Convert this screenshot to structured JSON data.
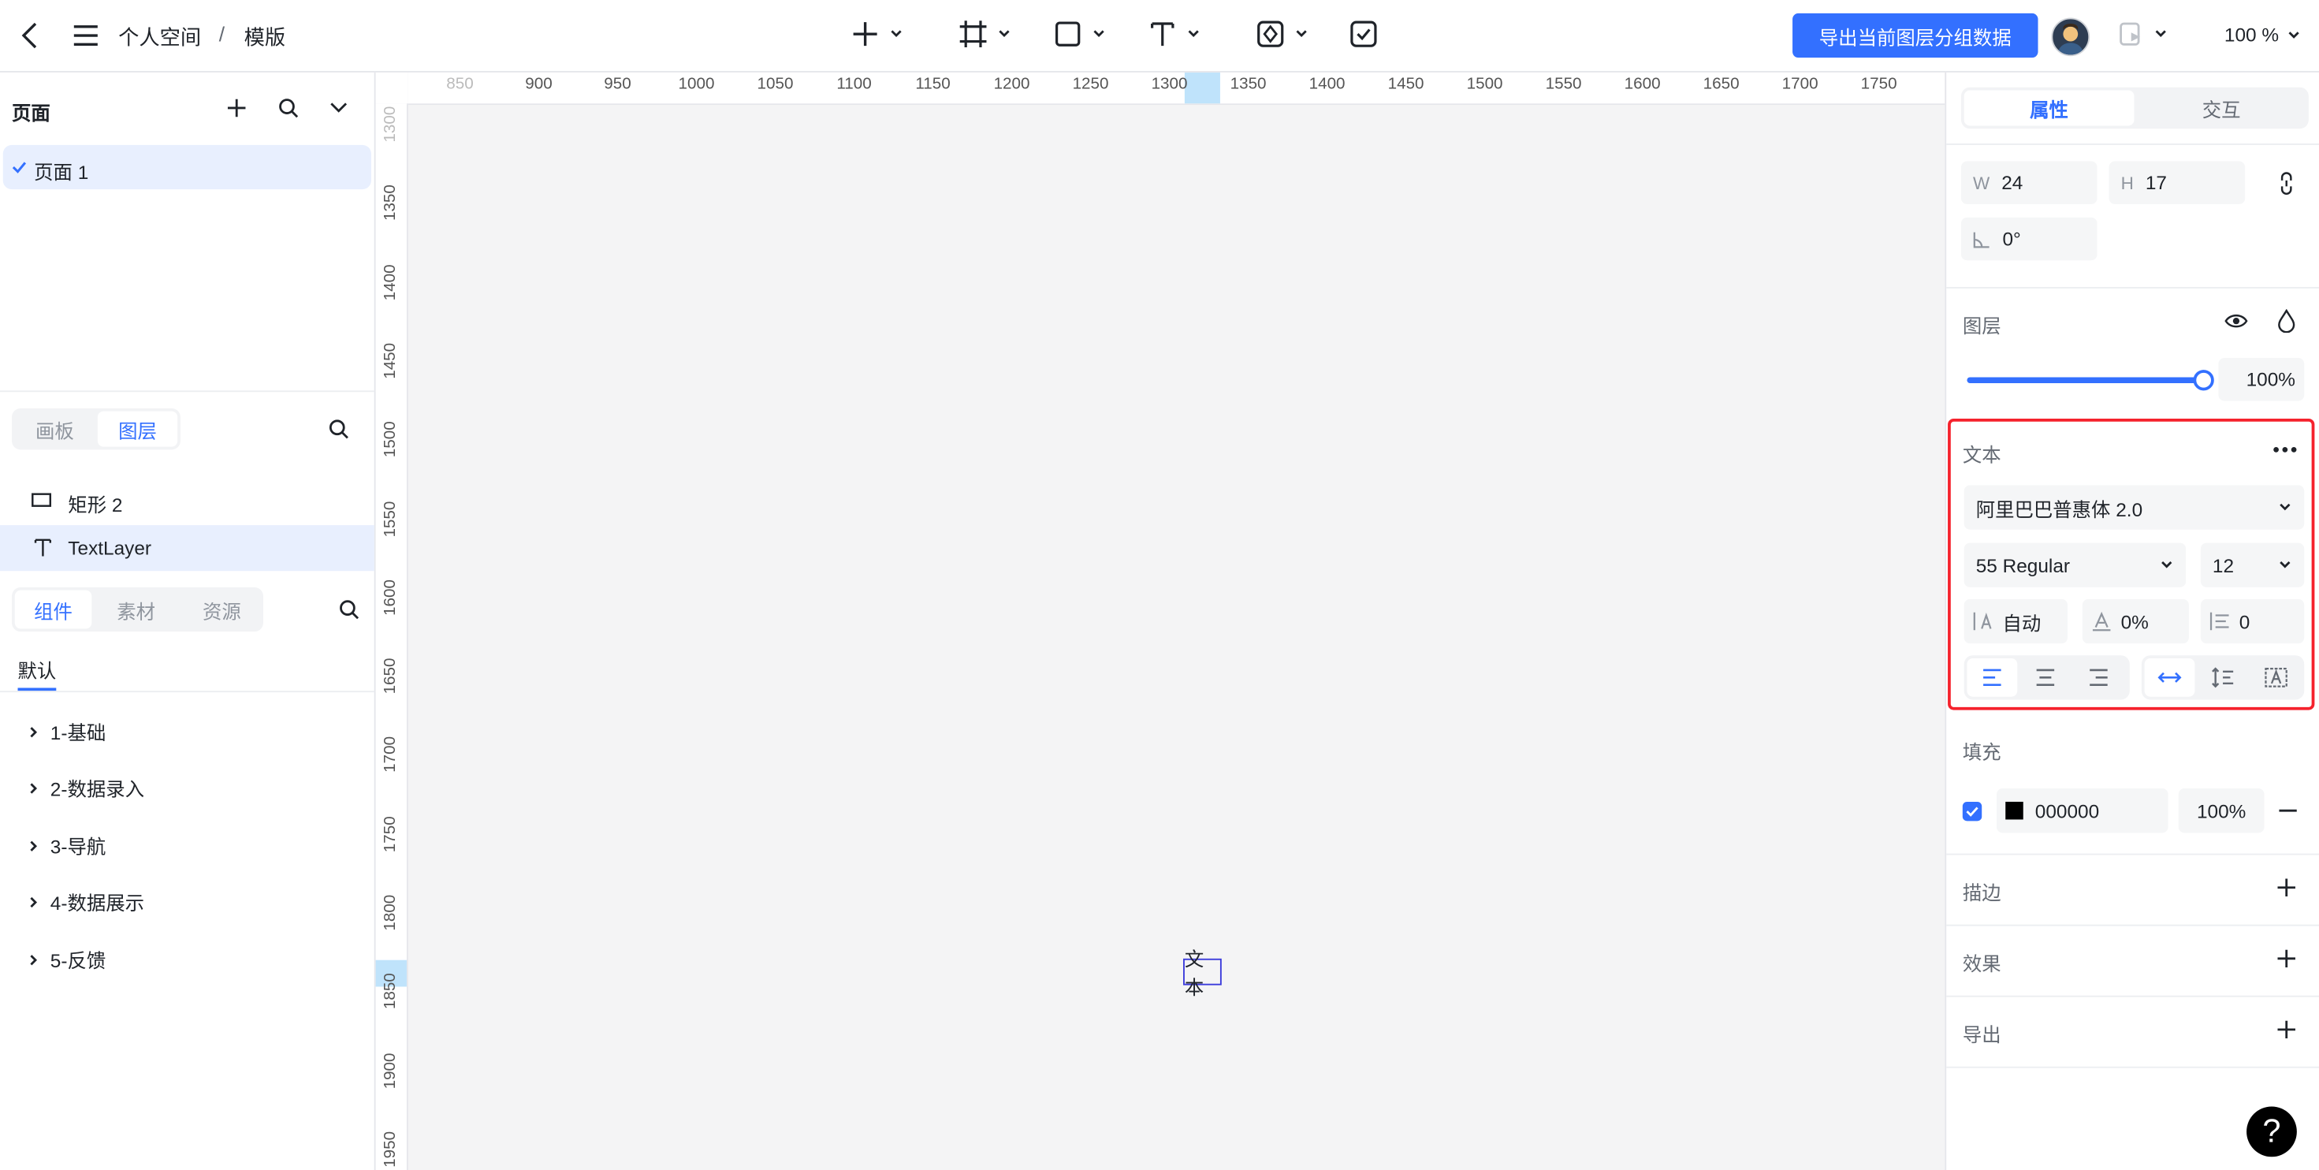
{
  "header": {
    "breadcrumb_space": "个人空间",
    "breadcrumb_sep": "/",
    "breadcrumb_file": "模版",
    "export_button": "导出当前图层分组数据",
    "zoom": "100 %"
  },
  "pages": {
    "title": "页面",
    "items": [
      {
        "label": "页面 1",
        "selected": true
      }
    ]
  },
  "layers_panel": {
    "tabs": [
      "画板",
      "图层"
    ],
    "active_tab": "图层",
    "items": [
      {
        "label": "矩形 2",
        "icon": "rectangle-icon"
      },
      {
        "label": "TextLayer",
        "icon": "text-icon",
        "selected": true
      }
    ]
  },
  "components_panel": {
    "tabs": [
      "组件",
      "素材",
      "资源"
    ],
    "active_tab": "组件",
    "subtab": "默认",
    "groups": [
      "1-基础",
      "2-数据录入",
      "3-导航",
      "4-数据展示",
      "5-反馈"
    ]
  },
  "ruler": {
    "h": [
      "850",
      "900",
      "950",
      "1000",
      "1050",
      "1100",
      "1150",
      "1200",
      "1250",
      "1300",
      "1350",
      "1400",
      "1450",
      "1500",
      "1550",
      "1600",
      "1650",
      "1700",
      "1750"
    ],
    "v": [
      "1300",
      "1350",
      "1400",
      "1450",
      "1500",
      "1550",
      "1600",
      "1650",
      "1700",
      "1750",
      "1800",
      "1850",
      "1900",
      "1950"
    ]
  },
  "canvas": {
    "text_element": "文本"
  },
  "inspector": {
    "tabs": [
      "属性",
      "交互"
    ],
    "active_tab": "属性",
    "size": {
      "w_label": "W",
      "w": "24",
      "h_label": "H",
      "h": "17"
    },
    "rotation": "0°",
    "layer": {
      "title": "图层",
      "opacity": "100%",
      "opacity_value": 1.0
    },
    "text": {
      "title": "文本",
      "font_family": "阿里巴巴普惠体 2.0",
      "font_weight": "55 Regular",
      "font_size": "12",
      "line_height": "自动",
      "letter_spacing": "0%",
      "paragraph_spacing": "0"
    },
    "fill": {
      "title": "填充",
      "color": "000000",
      "color_hex": "#000000",
      "opacity": "100%"
    },
    "stroke_title": "描边",
    "effect_title": "效果",
    "export_title": "导出"
  },
  "help": "?"
}
